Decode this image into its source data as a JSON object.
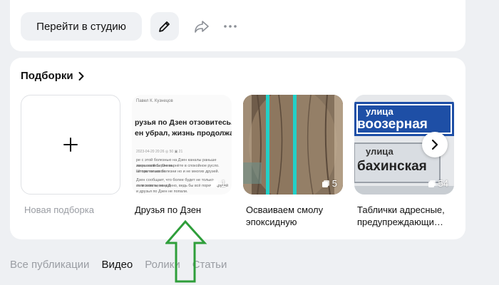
{
  "top_card": {
    "studio_button_label": "Перейти в студию"
  },
  "collections": {
    "title": "Подборки",
    "new_collection_label": "Новая подборка",
    "items": [
      {
        "label": "Друзья по Дзен",
        "count": "1",
        "thumb_text": {
          "author": "Павел К. Кузнецов",
          "line1": "рузья по Дзен отзовитесь. Бот",
          "line2": "ен убрал, жизнь продолжает",
          "meta": "2023-04-20 20:26    ◎ 50    ▣ 21",
          "para1": "ре с этой болезнью на Дзен каналы раньше закрывались. Очень",
          "para2": "ли на этой бирже вернёте в спокойное русло. Шторм не закон",
          "para3": "не так только болезни но и не многих друзей.",
          "para4": "Дзен сообщает, что более будет не только отписывать, но и Д",
          "para5": "ль в этом неожиданно, ведь бы всё порече друзей",
          "para6": "и друзья по Дзен не попали."
        }
      },
      {
        "label": "Осваиваем смолу эпоксидную",
        "count": "5"
      },
      {
        "label": "Таблички адресные, предупреждающи…",
        "count": "54",
        "thumb_text": {
          "sign1_prefix": "улица",
          "sign1_name": "воозерная",
          "sign2_prefix": "улица",
          "sign2_name": "бахинская"
        }
      }
    ]
  },
  "tabs": [
    {
      "label": "Все публикации",
      "active": false
    },
    {
      "label": "Видео",
      "active": true
    },
    {
      "label": "Ролики",
      "active": false
    },
    {
      "label": "Статьи",
      "active": false
    }
  ],
  "colors": {
    "page_bg": "#eef0f3",
    "card_bg": "#ffffff",
    "annotation_arrow": "#2e9e3a"
  }
}
